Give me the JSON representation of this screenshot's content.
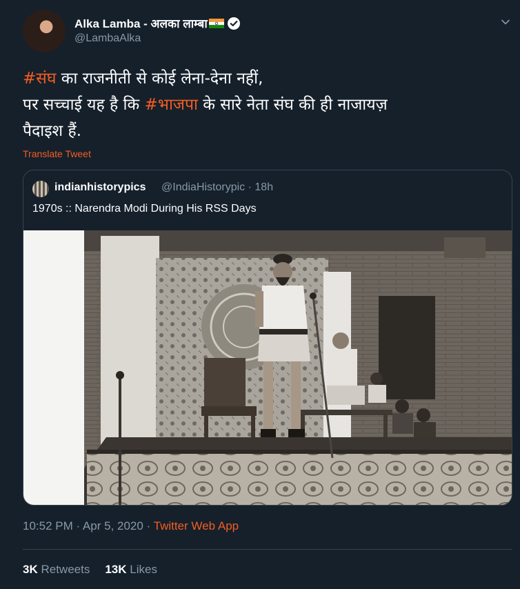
{
  "author": {
    "display_name": "Alka Lamba - अलका लाम्बा",
    "handle": "@LambaAlka"
  },
  "tweet": {
    "hashtag1": "#संघ",
    "line1_rest": " का राजनीती से कोई लेना-देना नहीं,",
    "line2_start": "पर सच्चाई यह है कि ",
    "hashtag2": "#भाजपा",
    "line2_rest": " के सारे नेता संघ की ही नाजायज़",
    "line3": "पैदाइश हैं.",
    "translate_label": "Translate Tweet"
  },
  "quoted": {
    "name": "indianhistorypics",
    "handle_time": "@IndiaHistorypic · 18h",
    "text": "1970s :: Narendra Modi During His RSS Days"
  },
  "meta": {
    "time_date": "10:52 PM · Apr 5, 2020 · ",
    "app": "Twitter Web App"
  },
  "stats": {
    "retweets_count": "3K",
    "retweets_label": "Retweets",
    "likes_count": "13K",
    "likes_label": "Likes"
  },
  "colors": {
    "background": "#15202b",
    "accent": "#f45d22",
    "secondary_text": "#8899a6",
    "border": "#38444d"
  },
  "icons": [
    "flag-icon",
    "verified-icon",
    "caret-down-icon"
  ]
}
